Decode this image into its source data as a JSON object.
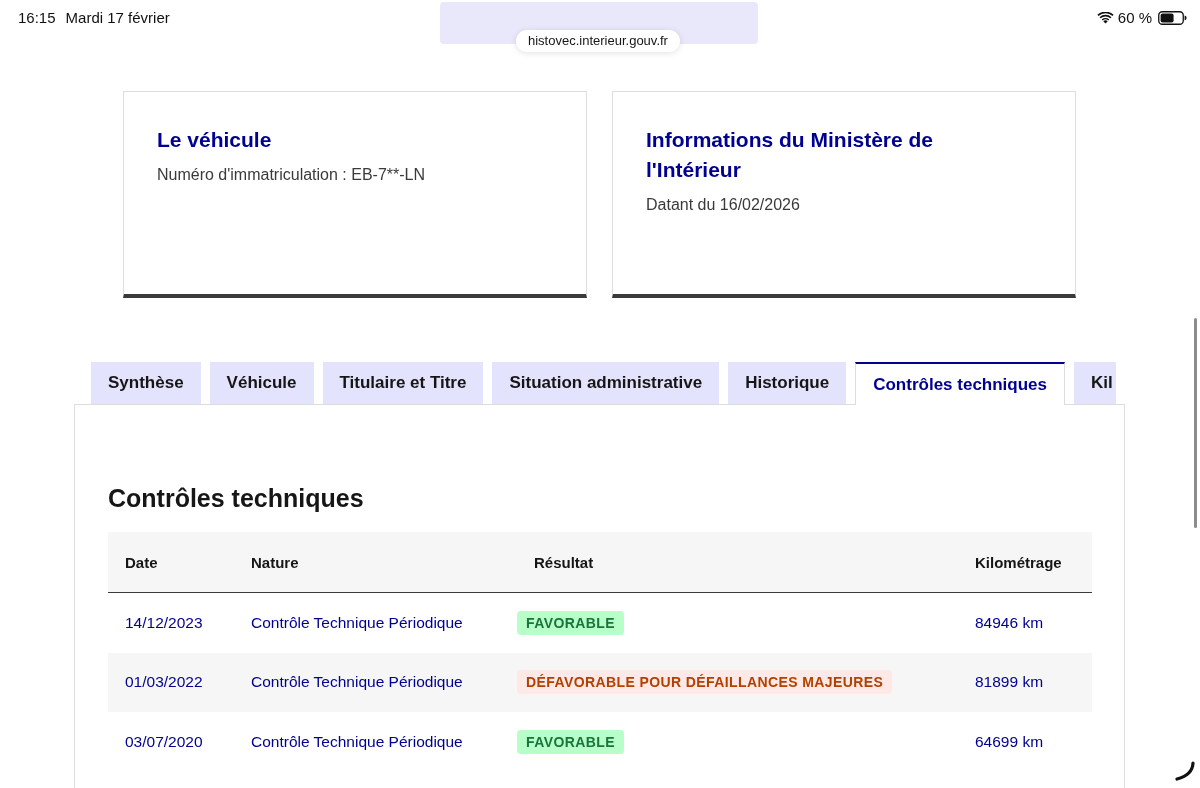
{
  "status_bar": {
    "time": "16:15",
    "date": "Mardi 17 février",
    "battery": "60 %"
  },
  "address_bar": {
    "url": "histovec.interieur.gouv.fr"
  },
  "cards": [
    {
      "title": "Le véhicule",
      "text": "Numéro d'immatriculation : EB-7**-LN"
    },
    {
      "title": "Informations du Ministère de l'Intérieur",
      "text": "Datant du 16/02/2026"
    }
  ],
  "tabs": [
    {
      "label": "Synthèse",
      "selected": false
    },
    {
      "label": "Véhicule",
      "selected": false
    },
    {
      "label": "Titulaire et Titre",
      "selected": false
    },
    {
      "label": "Situation administrative",
      "selected": false
    },
    {
      "label": "Historique",
      "selected": false
    },
    {
      "label": "Contrôles techniques",
      "selected": true
    },
    {
      "label": "Kil",
      "selected": false
    }
  ],
  "panel": {
    "title": "Contrôles techniques",
    "table": {
      "columns": [
        "Date",
        "Nature",
        "Résultat",
        "Kilométrage"
      ],
      "rows": [
        {
          "date": "14/12/2023",
          "nature": "Contrôle Technique Périodique",
          "result": {
            "label": "FAVORABLE",
            "kind": "success"
          },
          "mileage": "84946 km"
        },
        {
          "date": "01/03/2022",
          "nature": "Contrôle Technique Périodique",
          "result": {
            "label": "DÉFAVORABLE POUR DÉFAILLANCES MAJEURES",
            "kind": "error"
          },
          "mileage": "81899 km"
        },
        {
          "date": "03/07/2020",
          "nature": "Contrôle Technique Périodique",
          "result": {
            "label": "FAVORABLE",
            "kind": "success"
          },
          "mileage": "64699 km"
        }
      ]
    }
  }
}
